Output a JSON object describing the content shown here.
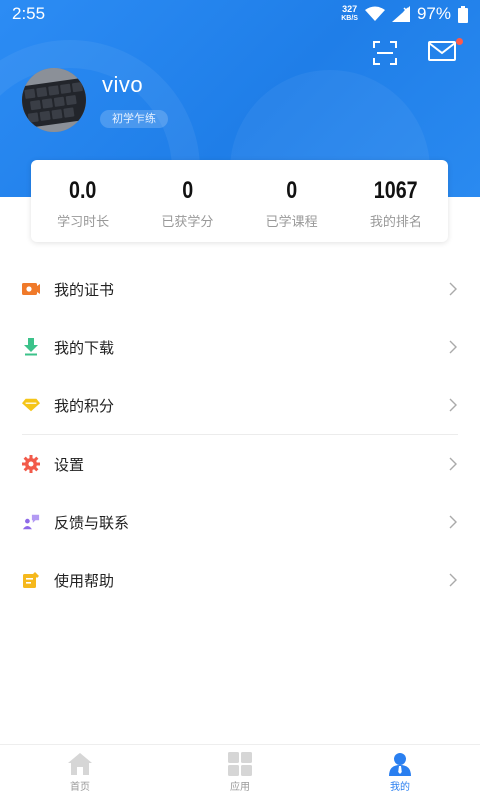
{
  "status_bar": {
    "time": "2:55",
    "net_speed_value": "327",
    "net_speed_unit": "KB/S",
    "battery": "97%"
  },
  "header": {
    "username": "vivo",
    "level": "初学乍练",
    "icons": [
      "scan-icon",
      "mail-icon"
    ],
    "accent_color": "#1f7ee8"
  },
  "stats": [
    {
      "value": "0.0",
      "label": "学习时长"
    },
    {
      "value": "0",
      "label": "已获学分"
    },
    {
      "value": "0",
      "label": "已学课程"
    },
    {
      "value": "1067",
      "label": "我的排名"
    }
  ],
  "menu": [
    {
      "label": "我的证书",
      "icon": "certificate-icon",
      "color": "#f07a2a"
    },
    {
      "label": "我的下载",
      "icon": "download-icon",
      "color": "#3cc28a"
    },
    {
      "label": "我的积分",
      "icon": "diamond-icon",
      "color": "#f5c518"
    },
    {
      "label": "设置",
      "icon": "gear-icon",
      "color": "#f25a4a"
    },
    {
      "label": "反馈与联系",
      "icon": "feedback-icon",
      "color": "#8e6ae8"
    },
    {
      "label": "使用帮助",
      "icon": "help-note-icon",
      "color": "#f5b81c"
    }
  ],
  "bottom_nav": [
    {
      "label": "首页",
      "icon": "home-icon",
      "active": false
    },
    {
      "label": "应用",
      "icon": "apps-grid-icon",
      "active": false
    },
    {
      "label": "我的",
      "icon": "profile-icon",
      "active": true
    }
  ]
}
